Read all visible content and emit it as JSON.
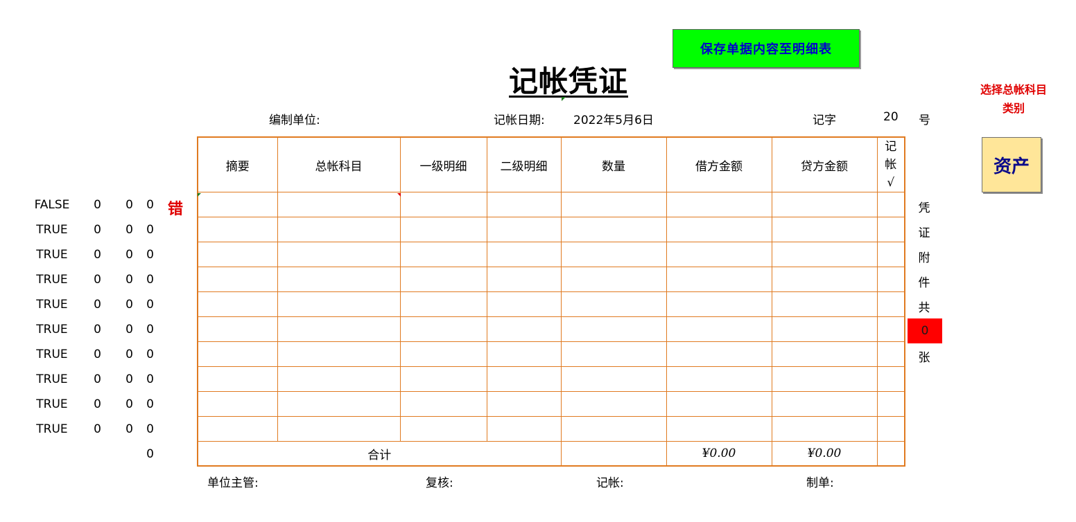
{
  "toolbar": {
    "save_label": "保存单据内容至明细表"
  },
  "voucher": {
    "title": "记帐凭证",
    "unit_label": "编制单位:",
    "date_label": "记帐日期:",
    "date_value": "2022年5月6日",
    "word_label": "记字",
    "number_value": "20",
    "number_suffix": "号",
    "columns": [
      "摘要",
      "总帐科目",
      "一级明细",
      "二级明细",
      "数量",
      "借方金额",
      "贷方金额",
      "记帐√"
    ],
    "total_label": "合计",
    "debit_total": "¥0.00",
    "credit_total": "¥0.00",
    "signatures": {
      "supervisor": "单位主管:",
      "review": "复核:",
      "bookkeeper": "记帐:",
      "preparer": "制单:"
    },
    "attachments": {
      "chars": [
        "凭",
        "证",
        "附",
        "件",
        "共"
      ],
      "count": "0",
      "suffix": "张"
    }
  },
  "sidebar_right": {
    "note": "选择总帐科目类别",
    "category_button": "资产"
  },
  "checks": {
    "rows": [
      {
        "flag": "FALSE",
        "a": "0",
        "b": "0",
        "c": "0"
      },
      {
        "flag": "TRUE",
        "a": "0",
        "b": "0",
        "c": "0"
      },
      {
        "flag": "TRUE",
        "a": "0",
        "b": "0",
        "c": "0"
      },
      {
        "flag": "TRUE",
        "a": "0",
        "b": "0",
        "c": "0"
      },
      {
        "flag": "TRUE",
        "a": "0",
        "b": "0",
        "c": "0"
      },
      {
        "flag": "TRUE",
        "a": "0",
        "b": "0",
        "c": "0"
      },
      {
        "flag": "TRUE",
        "a": "0",
        "b": "0",
        "c": "0"
      },
      {
        "flag": "TRUE",
        "a": "0",
        "b": "0",
        "c": "0"
      },
      {
        "flag": "TRUE",
        "a": "0",
        "b": "0",
        "c": "0"
      },
      {
        "flag": "TRUE",
        "a": "0",
        "b": "0",
        "c": "0"
      }
    ],
    "total": "0",
    "error_label": "错"
  },
  "colors": {
    "accent_border": "#e07a20",
    "save_bg": "#00ff00",
    "save_text": "#0000cc",
    "error_red": "#e00000",
    "category_bg": "#ffe699"
  }
}
